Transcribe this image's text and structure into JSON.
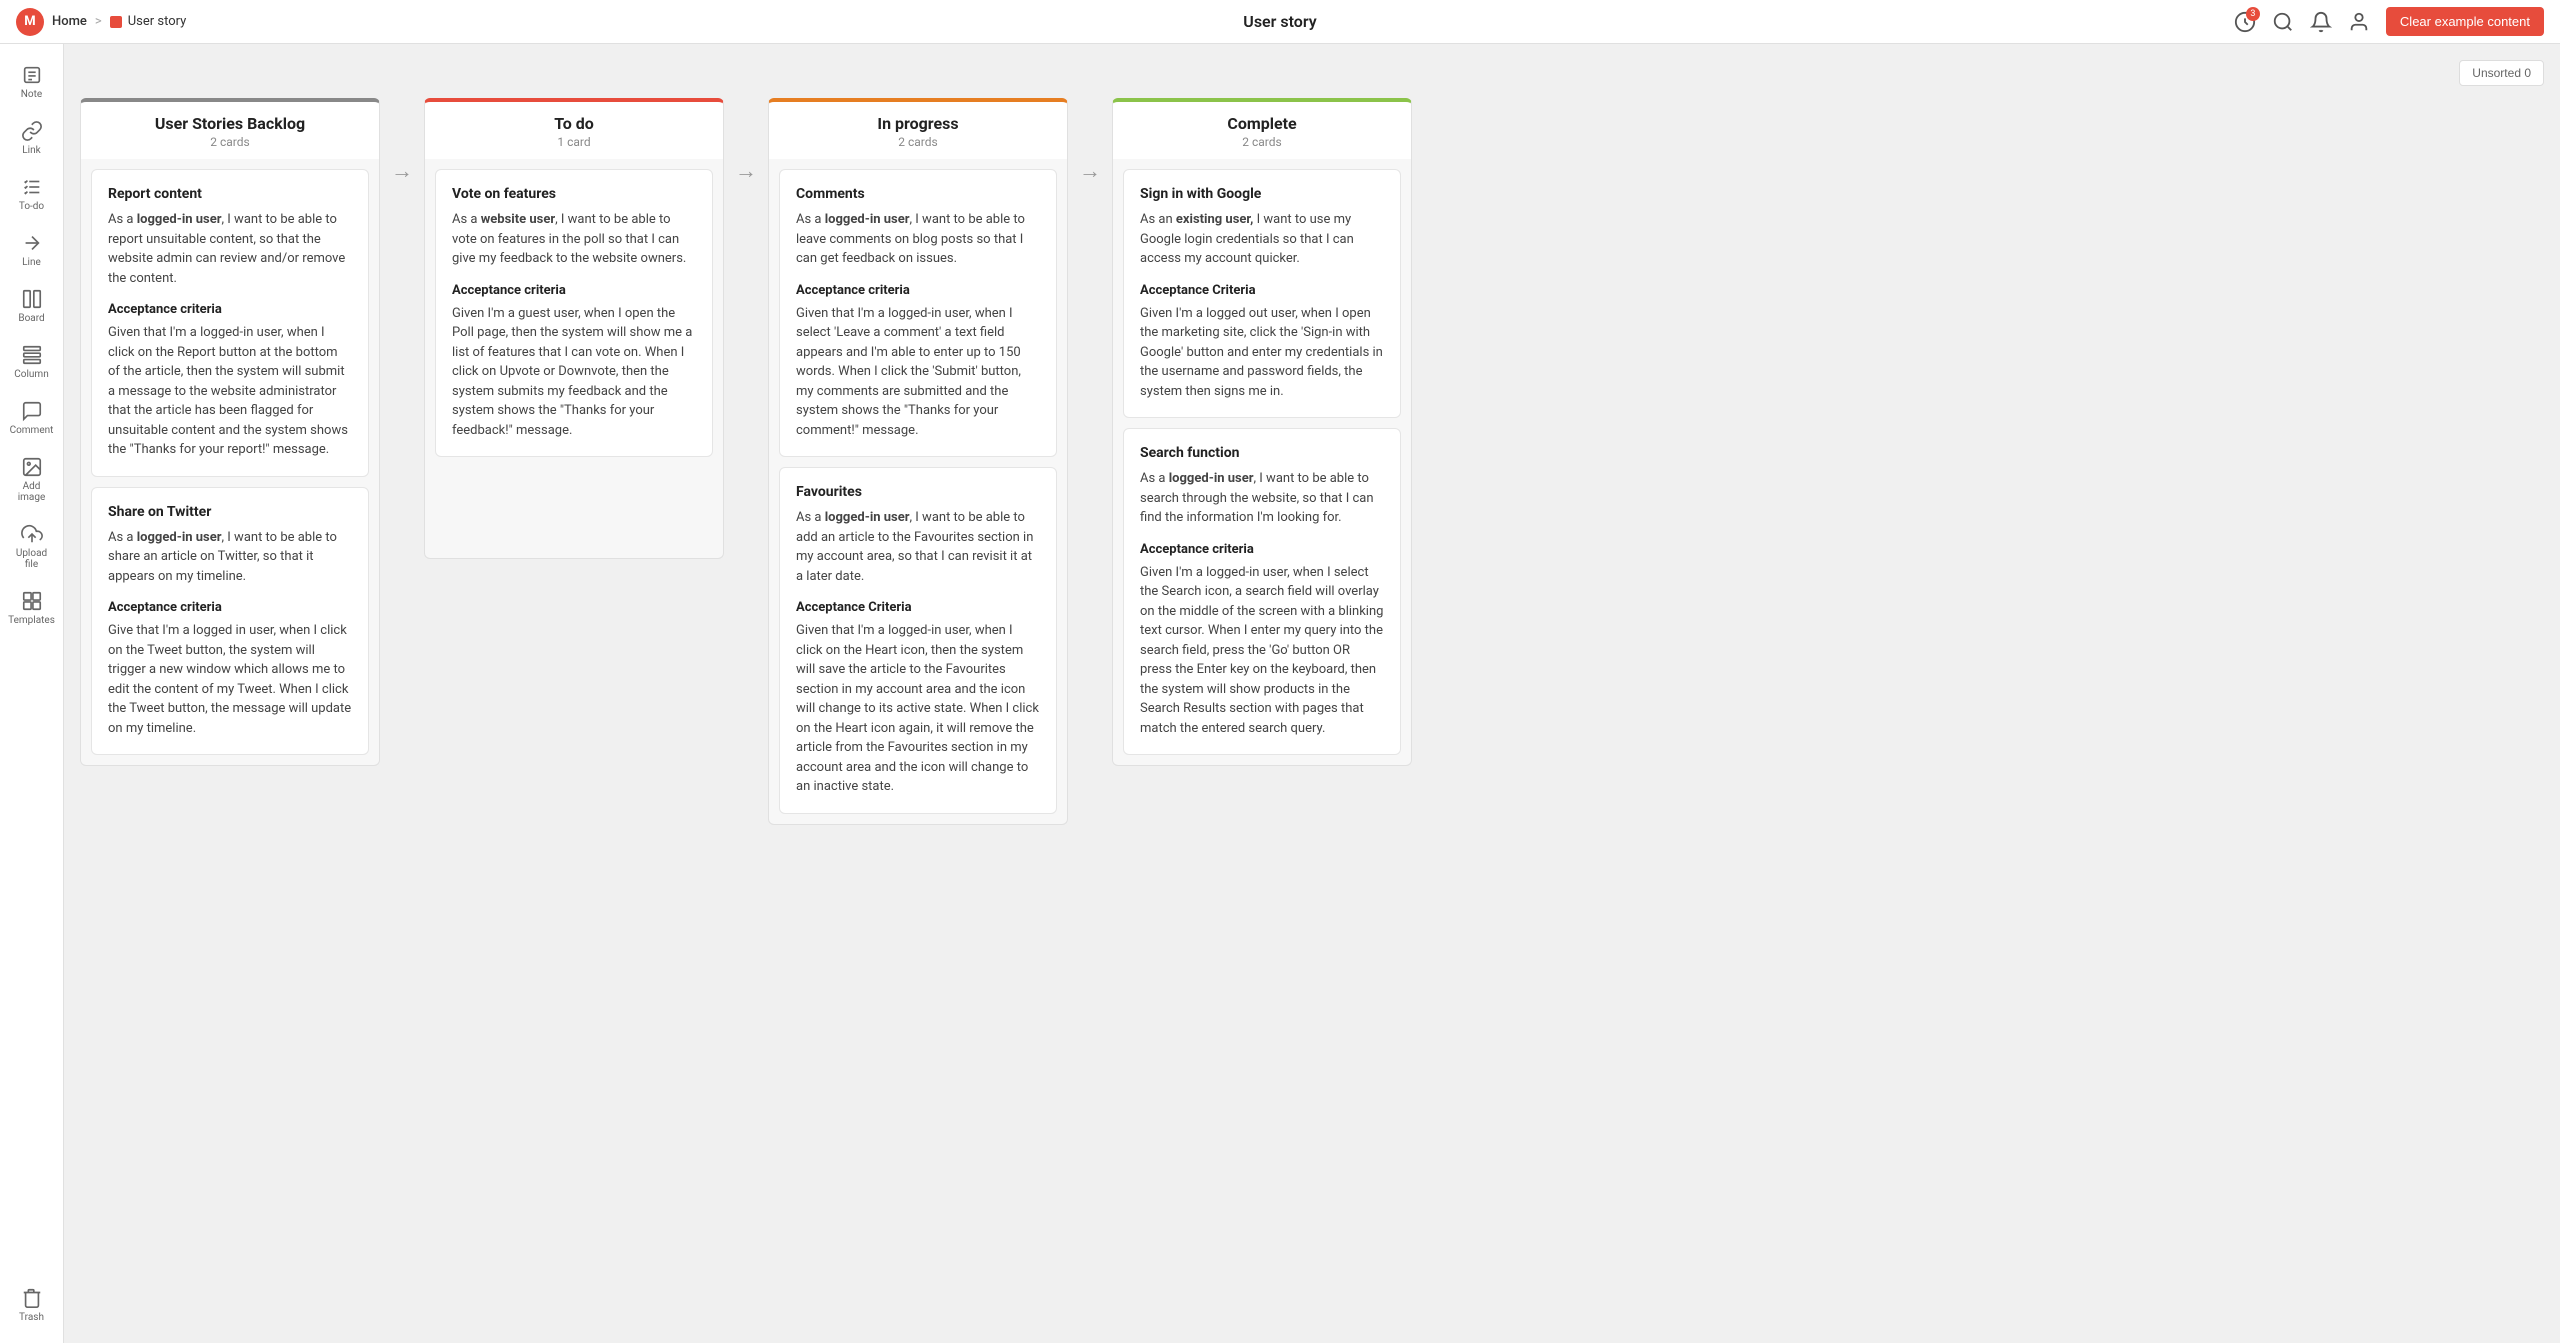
{
  "topbar": {
    "logo_text": "M",
    "home_label": "Home",
    "breadcrumb_sep": ">",
    "page_name": "User story",
    "page_title": "User story",
    "clear_btn_label": "Clear example content",
    "icons": {
      "notification_badge": "3"
    }
  },
  "toolbar": {
    "unsorted_label": "Unsorted 0"
  },
  "sidebar": {
    "items": [
      {
        "id": "note",
        "label": "Note",
        "icon": "note"
      },
      {
        "id": "link",
        "label": "Link",
        "icon": "link"
      },
      {
        "id": "todo",
        "label": "To-do",
        "icon": "todo"
      },
      {
        "id": "line",
        "label": "Line",
        "icon": "line"
      },
      {
        "id": "board",
        "label": "Board",
        "icon": "board"
      },
      {
        "id": "column",
        "label": "Column",
        "icon": "column"
      },
      {
        "id": "comment",
        "label": "Comment",
        "icon": "comment"
      },
      {
        "id": "add-image",
        "label": "Add image",
        "icon": "image"
      },
      {
        "id": "upload-file",
        "label": "Upload file",
        "icon": "upload"
      },
      {
        "id": "templates",
        "label": "Templates",
        "icon": "templates"
      }
    ],
    "trash_label": "Trash"
  },
  "columns": [
    {
      "id": "backlog",
      "title": "User Stories Backlog",
      "count": "2 cards",
      "color_class": "backlog",
      "cards": [
        {
          "title": "Report content",
          "intro": "As a <b>logged-in user</b>, I want to be able to report unsuitable content, so that the website admin can review and/or remove the content.",
          "criteria_title": "Acceptance criteria",
          "criteria": "Given that I'm a logged-in user, when I click on the Report button at the bottom of the article, then the system will submit a message to the website administrator that the article has been flagged for unsuitable content and the system shows the \"Thanks for your report!\" message."
        },
        {
          "title": "Share on Twitter",
          "intro": "As a <b>logged-in user</b>, I want to be able to share an article on Twitter, so that it appears on my timeline.",
          "criteria_title": "Acceptance criteria",
          "criteria": "Give that I'm a logged in user, when I click on the Tweet button, the system will trigger a new window which allows me to edit the content of my Tweet. When I click the Tweet button, the message will update on my timeline."
        }
      ]
    },
    {
      "id": "todo",
      "title": "To do",
      "count": "1 card",
      "color_class": "todo",
      "cards": [
        {
          "title": "Vote on features",
          "intro": "As a <b>website user</b>, I want to be able to vote on features in the poll so that I can give my feedback to the website owners.",
          "criteria_title": "Acceptance criteria",
          "criteria": "Given I'm a guest user, when I open the Poll page, then the system will show me a list of features that I can vote on. When I click on Upvote or Downvote, then the system submits my feedback and the system shows the \"Thanks for your feedback!\" message."
        }
      ]
    },
    {
      "id": "inprogress",
      "title": "In progress",
      "count": "2 cards",
      "color_class": "inprogress",
      "cards": [
        {
          "title": "Comments",
          "intro": "As a <b>logged-in user</b>, I want to be able to leave comments on blog posts so that I can get feedback on issues.",
          "criteria_title": "Acceptance criteria",
          "criteria": "Given that I'm a logged-in user, when I select 'Leave a comment' a text field appears and I'm able to enter up to 150 words. When I click the 'Submit' button, my comments are submitted and the system shows the \"Thanks for your comment!\" message."
        },
        {
          "title": "Favourites",
          "intro": "As a <b>logged-in user</b>, I want to be able to add an article to the Favourites section in my account area, so that I can revisit it at a later date.",
          "criteria_title": "Acceptance Criteria",
          "criteria": "Given that I'm a logged-in user, when I click on the Heart icon, then the system will save the article to the Favourites section in my account area and the icon will change to its active state. When I click on the Heart icon again, it will remove the article from the Favourites section in my account area and the icon will change to an inactive state."
        }
      ]
    },
    {
      "id": "complete",
      "title": "Complete",
      "count": "2 cards",
      "color_class": "complete",
      "cards": [
        {
          "title": "Sign in with Google",
          "intro": "As an <b>existing user,</b> I want to use my Google login credentials so that I can access my account quicker.",
          "criteria_title": "Acceptance Criteria",
          "criteria": "Given I'm a logged out user, when I open the marketing site, click the 'Sign-in with Google' button and enter my credentials in the username and password fields, the system then signs me in."
        },
        {
          "title": "Search function",
          "intro": "As a <b>logged-in user</b>, I want to be able to search through the website, so that I can find the information I'm looking for.",
          "criteria_title": "Acceptance criteria",
          "criteria": "Given I'm a logged-in user, when I select the Search icon, a search field will overlay on the middle of the screen with a blinking text cursor. When I enter my query into the search field, press the 'Go' button OR press the Enter key on the keyboard, then the system will show products in the Search Results section with pages that match the entered search query."
        }
      ]
    }
  ]
}
